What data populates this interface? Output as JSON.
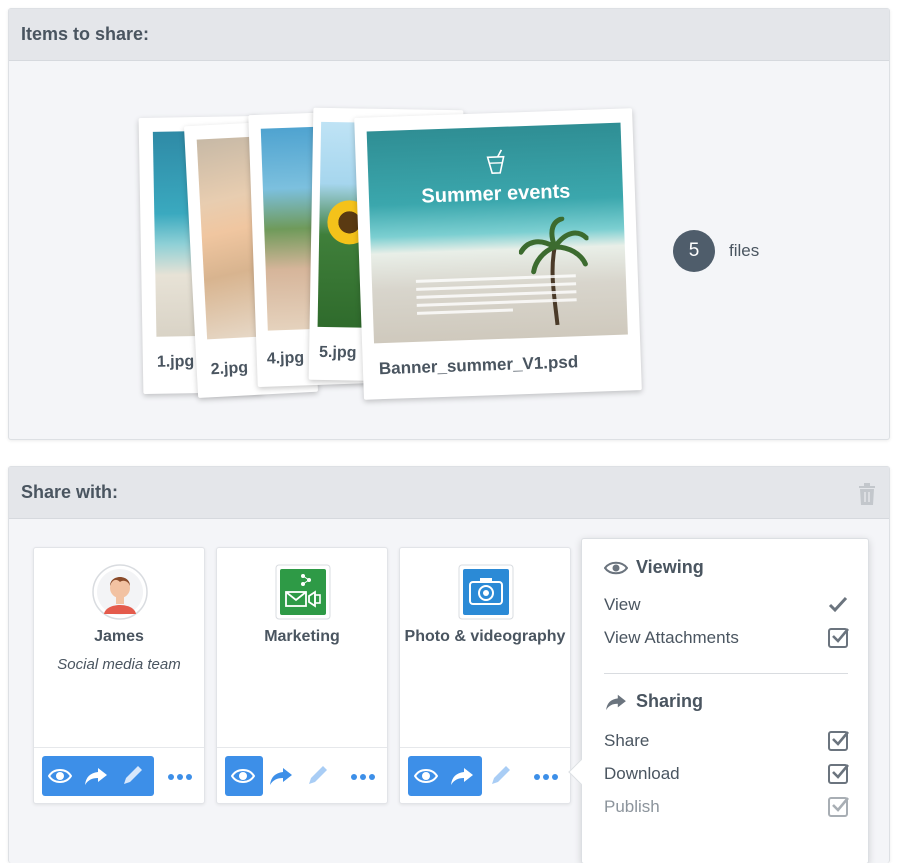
{
  "items_panel": {
    "title": "Items to share:",
    "files": [
      {
        "caption": "1.jpg"
      },
      {
        "caption": "2.jpg"
      },
      {
        "caption": "4.jpg"
      },
      {
        "caption": "5.jpg"
      },
      {
        "caption": "Banner_summer_V1.psd"
      }
    ],
    "banner_heading": "Summer events",
    "file_count": "5",
    "file_count_label": "files"
  },
  "share_panel": {
    "title": "Share with:",
    "recipients": [
      {
        "name": "James",
        "subtitle": "Social media team",
        "icon": "user-avatar-icon"
      },
      {
        "name": "Marketing",
        "subtitle": "",
        "icon": "marketing-group-icon"
      },
      {
        "name": "Photo & videography",
        "subtitle": "",
        "icon": "camera-icon"
      }
    ],
    "permissions": {
      "viewing_title": "Viewing",
      "viewing": [
        {
          "label": "View",
          "state": "locked-check"
        },
        {
          "label": "View Attachments",
          "state": "checked"
        }
      ],
      "sharing_title": "Sharing",
      "sharing": [
        {
          "label": "Share",
          "state": "checked"
        },
        {
          "label": "Download",
          "state": "checked"
        },
        {
          "label": "Publish",
          "state": "checked-disabled"
        }
      ]
    }
  },
  "colors": {
    "accent_blue": "#3d8fe8",
    "header_bg": "#e4e6ea",
    "badge_bg": "#4f5d6b",
    "marketing_green": "#2e9a46",
    "camera_blue": "#2b8ad6"
  }
}
